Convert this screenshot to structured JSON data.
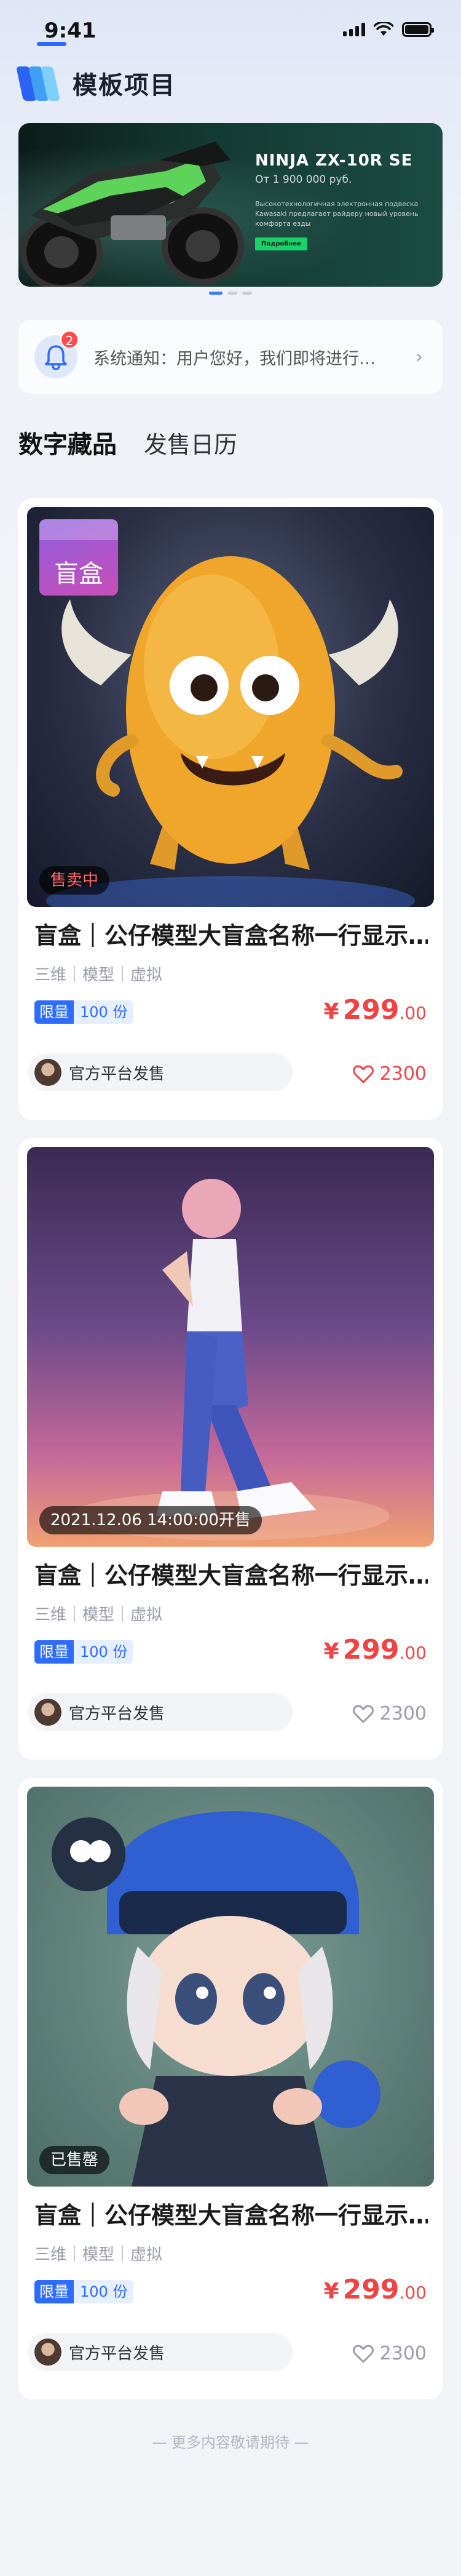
{
  "status_bar": {
    "time": "9:41"
  },
  "header": {
    "title": "模板项目"
  },
  "banner": {
    "title": "NINJA ZX-10R SE",
    "subtitle": "От 1 900 000 руб.",
    "description": "Высокотехнологичная электронная подвеска Kawasaki предлагает райдеру новый уровень комфорта езды",
    "button": "Подробнее",
    "slides_total": 3,
    "active_slide": 1
  },
  "notice": {
    "badge": "2",
    "text": "系统通知：用户您好，我们即将进行…",
    "arrow": "›"
  },
  "tabs": [
    {
      "label": "数字藏品",
      "active": true
    },
    {
      "label": "发售日历",
      "active": false
    }
  ],
  "cards": [
    {
      "box_tag": "盲盒",
      "status": "售卖中",
      "title": "盲盒｜公仔模型大盲盒名称一行显示…",
      "tags": "三维｜模型｜虚拟",
      "limit_label": "限量",
      "limit_value": "100 份",
      "price_symbol": "¥",
      "price_int": "299",
      "price_dec": ".00",
      "publisher": "官方平台发售",
      "likes": "2300",
      "liked": true
    },
    {
      "status": "2021.12.06 14:00:00开售",
      "title": "盲盒｜公仔模型大盲盒名称一行显示…",
      "tags": "三维｜模型｜虚拟",
      "limit_label": "限量",
      "limit_value": "100 份",
      "price_symbol": "¥",
      "price_int": "299",
      "price_dec": ".00",
      "publisher": "官方平台发售",
      "likes": "2300",
      "liked": false
    },
    {
      "status": "已售罄",
      "title": "盲盒｜公仔模型大盲盒名称一行显示…",
      "tags": "三维｜模型｜虚拟",
      "limit_label": "限量",
      "limit_value": "100 份",
      "price_symbol": "¥",
      "price_int": "299",
      "price_dec": ".00",
      "publisher": "官方平台发售",
      "likes": "2300",
      "liked": false
    }
  ],
  "footer": {
    "text": "— 更多内容敬请期待 —"
  },
  "colors": {
    "accent": "#2e6bff",
    "price": "#f04444",
    "badge": "#ff4d4f"
  }
}
